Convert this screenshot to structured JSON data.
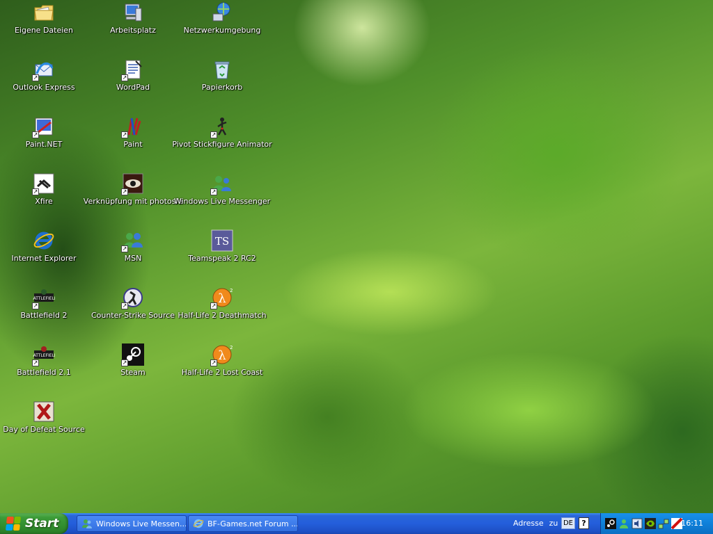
{
  "desktop": {
    "icons": [
      {
        "label": "Eigene Dateien",
        "icon": "my-documents-icon"
      },
      {
        "label": "Arbeitsplatz",
        "icon": "my-computer-icon"
      },
      {
        "label": "Netzwerkumgebung",
        "icon": "network-places-icon"
      },
      {
        "label": "Outlook Express",
        "icon": "outlook-express-icon"
      },
      {
        "label": "WordPad",
        "icon": "wordpad-icon"
      },
      {
        "label": "Papierkorb",
        "icon": "recycle-bin-icon"
      },
      {
        "label": "Paint.NET",
        "icon": "paint-net-icon"
      },
      {
        "label": "Paint",
        "icon": "paint-icon"
      },
      {
        "label": "Pivot Stickfigure Animator",
        "icon": "pivot-icon"
      },
      {
        "label": "Xfire",
        "icon": "xfire-icon"
      },
      {
        "label": "Verknüpfung mit photosle",
        "icon": "photoshop-eye-icon"
      },
      {
        "label": "Windows Live Messenger",
        "icon": "messenger-icon"
      },
      {
        "label": "Internet Explorer",
        "icon": "internet-explorer-icon"
      },
      {
        "label": "MSN",
        "icon": "msn-icon"
      },
      {
        "label": "Teamspeak 2 RC2",
        "icon": "teamspeak-icon"
      },
      {
        "label": "Battlefield 2",
        "icon": "battlefield-icon"
      },
      {
        "label": "Counter-Strike Source",
        "icon": "counter-strike-icon"
      },
      {
        "label": "Half-Life 2 Deathmatch",
        "icon": "half-life-icon"
      },
      {
        "label": "Battlefield 2.1",
        "icon": "battlefield-icon"
      },
      {
        "label": "Steam",
        "icon": "steam-icon"
      },
      {
        "label": "Half-Life 2 Lost Coast",
        "icon": "half-life-icon"
      },
      {
        "label": "Day of Defeat Source",
        "icon": "day-of-defeat-icon"
      }
    ]
  },
  "taskbar": {
    "start_label": "Start",
    "tasks": [
      {
        "label": "Windows Live Messen...",
        "icon": "messenger-icon"
      },
      {
        "label": "BF-Games.net Forum ...",
        "icon": "internet-explorer-icon"
      }
    ],
    "address_label": "Adresse",
    "address_suffix": "zu",
    "language": "DE",
    "help": "?",
    "clock": "16:11",
    "tray_icons": [
      "steam-tray-icon",
      "messenger-tray-icon",
      "volume-icon",
      "nvidia-icon",
      "network-icon",
      "antivirus-icon"
    ]
  },
  "colors": {
    "taskbar_blue": "#245edb",
    "start_green": "#3c9c38",
    "tray_blue": "#0f80d9"
  }
}
